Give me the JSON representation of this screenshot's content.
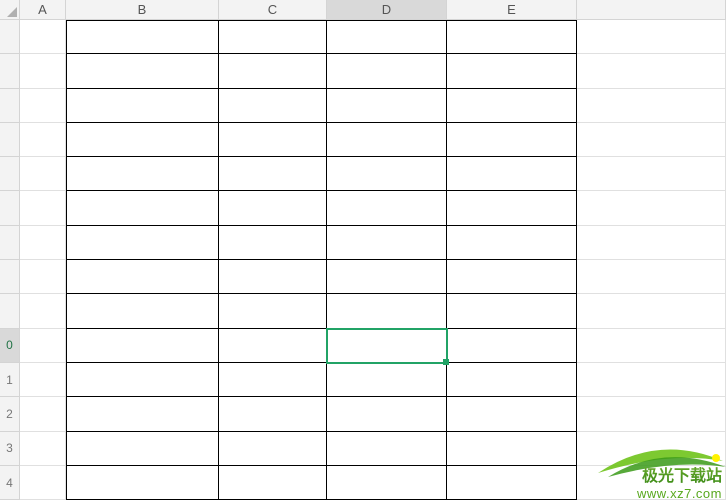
{
  "columns": [
    "A",
    "B",
    "C",
    "D",
    "E",
    ""
  ],
  "row_headers": [
    "",
    "",
    "",
    "",
    "",
    "",
    "",
    "",
    "",
    "0",
    "1",
    "2",
    "3",
    "4"
  ],
  "selected_column_index": 3,
  "selected_row_index": 9,
  "active_cell": {
    "col": 3,
    "row": 9
  },
  "bordered_range": {
    "col_start": 1,
    "col_end": 4,
    "row_start": 0,
    "row_end": 13
  },
  "watermark": {
    "title": "极光下载站",
    "url": "www.xz7.com"
  },
  "colors": {
    "accent": "#21a366",
    "header_bg": "#f3f3f3",
    "header_sel": "#d9d9d9"
  }
}
